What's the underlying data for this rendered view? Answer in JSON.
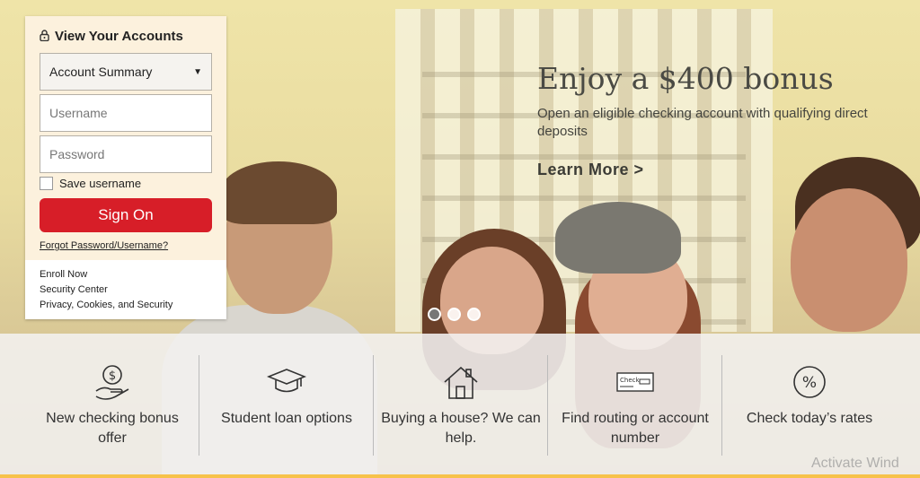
{
  "login": {
    "heading": "View Your Accounts",
    "account_select": "Account Summary",
    "username_placeholder": "Username",
    "password_placeholder": "Password",
    "save_username": "Save username",
    "sign_on": "Sign On",
    "forgot": "Forgot Password/Username?",
    "links": [
      "Enroll Now",
      "Security Center",
      "Privacy, Cookies, and Security"
    ]
  },
  "promo": {
    "title": "Enjoy a $400 bonus",
    "subtitle": "Open an eligible checking account with qualifying direct deposits",
    "cta": "Learn More >"
  },
  "carousel": {
    "count": 3,
    "active": 1
  },
  "quicklinks": [
    {
      "label": "New checking bonus offer",
      "icon": "money-hand-icon"
    },
    {
      "label": "Student loan options",
      "icon": "graduation-cap-icon"
    },
    {
      "label": "Buying a house? We can help.",
      "icon": "house-icon"
    },
    {
      "label": "Find routing or account number",
      "icon": "check-icon"
    },
    {
      "label": "Check today’s rates",
      "icon": "percent-icon"
    }
  ],
  "watermark": "Activate Wind",
  "colors": {
    "accent": "#d71e28",
    "panel": "#fcf1dd",
    "bottom_line": "#f7c24a"
  }
}
